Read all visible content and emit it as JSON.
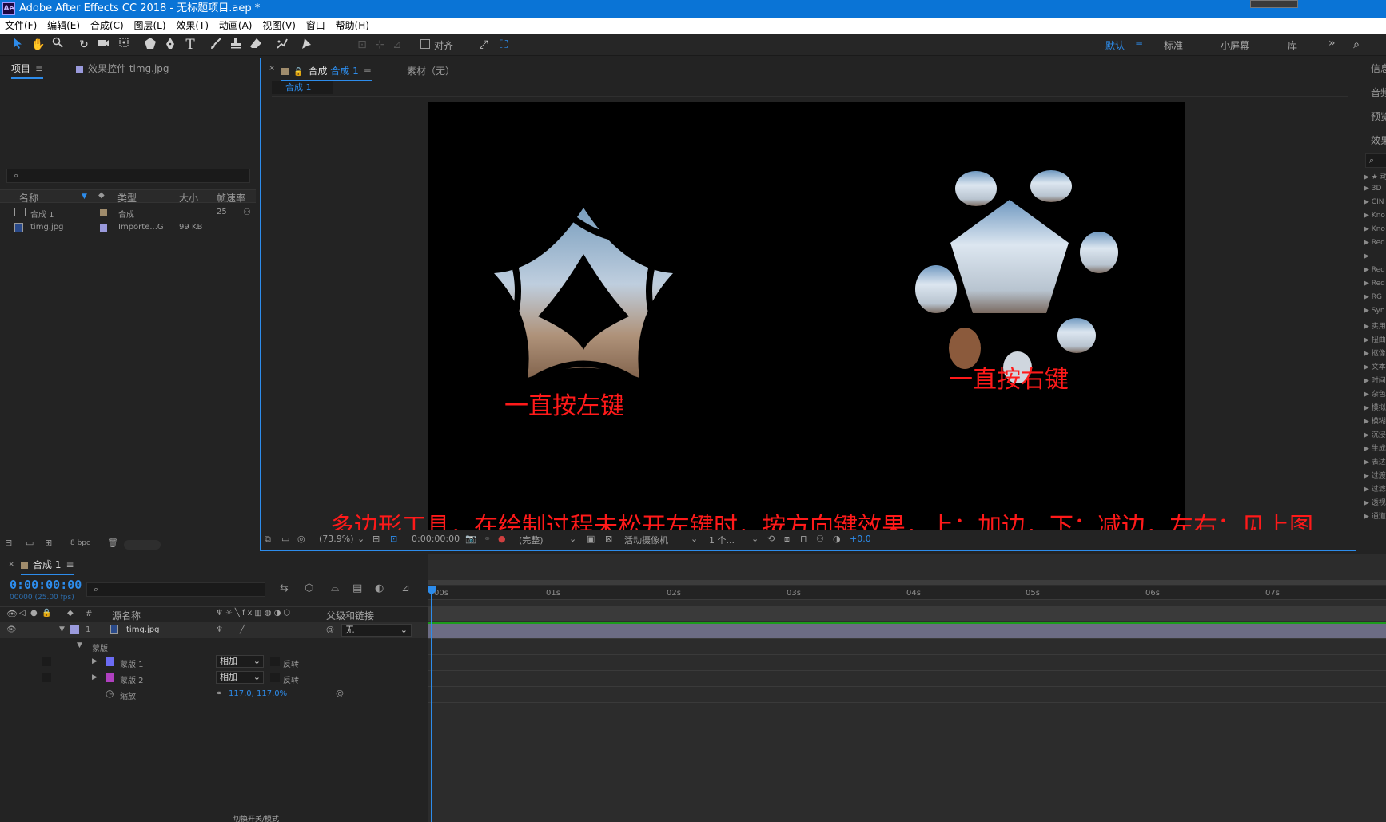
{
  "window": {
    "title": "Adobe After Effects CC 2018 - 无标题项目.aep *",
    "app_logo": "Ae"
  },
  "menu": [
    "文件(F)",
    "编辑(E)",
    "合成(C)",
    "图层(L)",
    "效果(T)",
    "动画(A)",
    "视图(V)",
    "窗口",
    "帮助(H)"
  ],
  "toolbar": {
    "tools": [
      "selection-tool",
      "hand-tool",
      "zoom-tool",
      "rotation-tool",
      "camera-tool",
      "pan-behind-tool",
      "polygon-tool",
      "pen-tool",
      "type-tool",
      "brush-tool",
      "clone-stamp-tool",
      "eraser-tool",
      "roto-brush-tool",
      "puppet-pin-tool"
    ],
    "align_label": "对齐",
    "workspaces": [
      "默认",
      "标准",
      "小屏幕",
      "库"
    ],
    "active_workspace": "默认"
  },
  "project_panel": {
    "tab_project": "项目",
    "tab_effects": "效果控件 timg.jpg",
    "search_placeholder": "",
    "columns": [
      "名称",
      "类型",
      "大小",
      "帧速率"
    ],
    "items": [
      {
        "name": "合成 1",
        "type": "合成",
        "size": "",
        "fps": "25",
        "label_color": "#a08c6c"
      },
      {
        "name": "timg.jpg",
        "type": "Importe...G",
        "size": "99 KB",
        "fps": "",
        "label_color": "#9a9adc"
      }
    ],
    "footer_bpc": "8 bpc"
  },
  "composition_panel": {
    "tab_comp_prefix": "合成",
    "tab_comp_name": "合成 1",
    "tab_footage": "素材（无）",
    "flow_tab": "合成 1",
    "annotations": {
      "left_shape": "一直按左键",
      "right_shape": "一直按右键",
      "instructions": "多边形工具，在绘制过程未松开左键时，按方向键效果，上：加边，下：减边，左右：见上图"
    },
    "viewer_bar": {
      "zoom": "(73.9%)",
      "timecode": "0:00:00:00",
      "resolution": "(完整)",
      "camera": "活动摄像机",
      "views": "1 个...",
      "exposure": "+0.0"
    }
  },
  "timeline_panel": {
    "tab": "合成 1",
    "timecode": "0:00:00:00",
    "frame_info": "00000 (25.00 fps)",
    "column_headers": {
      "source_name": "源名称",
      "number": "#",
      "parent": "父级和链接"
    },
    "layers": [
      {
        "number": "1",
        "name": "timg.jpg",
        "parent": "无",
        "label_color": "#9a9adc"
      }
    ],
    "masks_group": "蒙版",
    "masks": [
      {
        "name": "蒙版 1",
        "mode": "相加",
        "invert_label": "反转",
        "color": "#6c6cf4"
      },
      {
        "name": "蒙版 2",
        "mode": "相加",
        "invert_label": "反转",
        "color": "#b040c0"
      }
    ],
    "scale_label": "缩放",
    "scale_value": "117.0, 117.0%",
    "ruler": [
      "00s",
      "01s",
      "02s",
      "03s",
      "04s",
      "05s",
      "06s",
      "07s"
    ],
    "bottom_label": "切换开关/模式"
  },
  "right_panel": {
    "items": [
      "信息",
      "音频",
      "预览",
      "效果"
    ],
    "effects": [
      "★ 动",
      "3D",
      "CIN",
      "Kno",
      "Kno",
      "Red",
      "",
      "Red",
      "Red",
      "RG",
      "Syn",
      "实用",
      "扭曲",
      "抠像",
      "文本",
      "时间",
      "杂色",
      "模拟",
      "模糊",
      "沉浸",
      "生成",
      "表达",
      "过渡",
      "过滤",
      "透视",
      "通道"
    ]
  },
  "colors": {
    "accent": "#2d8ceb",
    "annotation": "#ff1a1a",
    "timeline_bar": "#1c9b1c"
  }
}
